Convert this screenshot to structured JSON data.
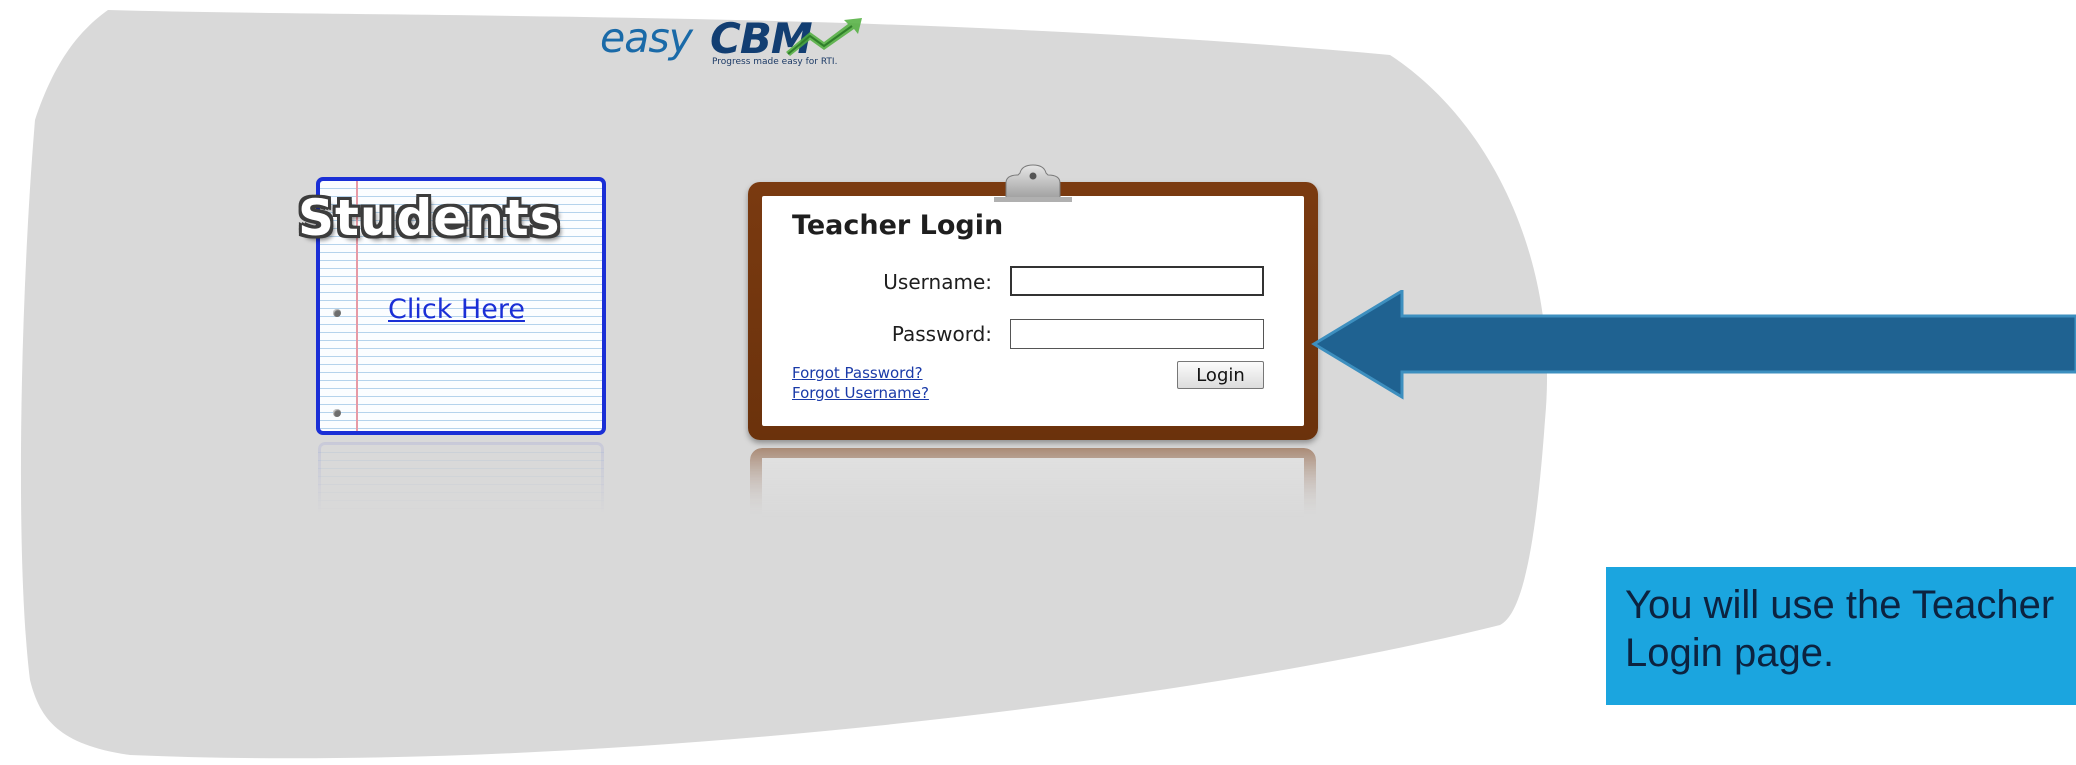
{
  "logo": {
    "brand_prefix": "easy",
    "brand_suffix": "CBM",
    "tagline": "Progress made easy for RTI."
  },
  "students": {
    "title": "Students",
    "link_label": "Click Here"
  },
  "teacher_login": {
    "title": "Teacher Login",
    "username_label": "Username:",
    "password_label": "Password:",
    "username_value": "",
    "password_value": "",
    "forgot_password": "Forgot Password?",
    "forgot_username": "Forgot Username?",
    "login_button": "Login"
  },
  "annotation": {
    "callout_line1": "You will use the Teacher",
    "callout_line2": "Login page.",
    "arrow_color": "#1f6291",
    "callout_color": "#1ba5df"
  },
  "colors": {
    "background_shape": "#d9d9d9",
    "clipboard": "#7a3a10",
    "notebook_border": "#1a2fd6"
  }
}
